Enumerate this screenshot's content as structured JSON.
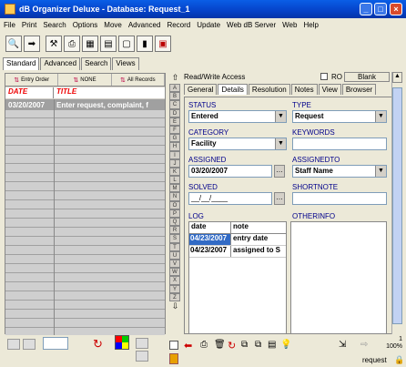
{
  "window": {
    "title": "dB Organizer Deluxe - Database: Request_1"
  },
  "menu": [
    "File",
    "Print",
    "Search",
    "Options",
    "Move",
    "Advanced",
    "Record",
    "Update",
    "Web dB Server",
    "Web",
    "Help"
  ],
  "toolbar_icons": [
    "search-icon",
    "export-icon",
    "tools-icon",
    "print-icon",
    "table-icon",
    "form-icon",
    "page-icon",
    "chart-icon",
    "calculator-icon"
  ],
  "view_tabs": [
    "Standard",
    "Advanced",
    "Search",
    "Views"
  ],
  "order_bar": {
    "entry_order": "Entry Order",
    "none": "NONE",
    "all_records": "All Records"
  },
  "grid": {
    "columns": [
      "DATE",
      "TITLE"
    ],
    "rows": [
      [
        "03/20/2007",
        "Enter request, complaint, f"
      ]
    ]
  },
  "alphabet": [
    "A",
    "B",
    "C",
    "D",
    "E",
    "F",
    "G",
    "H",
    "I",
    "J",
    "K",
    "L",
    "M",
    "N",
    "O",
    "P",
    "Q",
    "R",
    "S",
    "T",
    "U",
    "V",
    "W",
    "X",
    "Y",
    "Z"
  ],
  "right": {
    "access_label": "Read/Write Access",
    "ro_label": "RO",
    "blank_button": "Blank",
    "tabs": [
      "General",
      "Details",
      "Resolution",
      "Notes",
      "View",
      "Browser"
    ],
    "active_tab": "Details",
    "fields": {
      "status": {
        "label": "STATUS",
        "value": "Entered"
      },
      "type": {
        "label": "TYPE",
        "value": "Request"
      },
      "category": {
        "label": "CATEGORY",
        "value": "Facility"
      },
      "keywords": {
        "label": "KEYWORDS",
        "value": ""
      },
      "assigned": {
        "label": "ASSIGNED",
        "value": "03/20/2007"
      },
      "assignedto": {
        "label": "ASSIGNEDTO",
        "value": "Staff Name"
      },
      "solved": {
        "label": "SOLVED",
        "value": "__/__/____"
      },
      "shortnote": {
        "label": "SHORTNOTE",
        "value": ""
      },
      "log": {
        "label": "LOG",
        "columns": [
          "date",
          "note"
        ],
        "rows": [
          [
            "04/23/2007",
            "entry date"
          ],
          [
            "04/23/2007",
            "assigned to S"
          ]
        ]
      },
      "otherinfo": {
        "label": "OTHERINFO",
        "value": ""
      }
    }
  },
  "status": {
    "record_name": "request",
    "count": "1",
    "zoom": "100%"
  },
  "colors": {
    "title_bar": "#0542c8",
    "label_blue": "#00008b",
    "header_red": "#e00000",
    "row_gray": "#a0a0a0"
  }
}
